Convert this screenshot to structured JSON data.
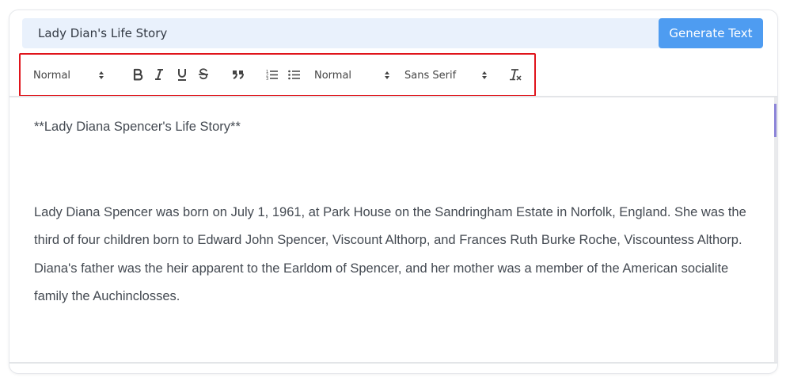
{
  "prompt": {
    "value": "Lady Dian's Life Story"
  },
  "generate_button": {
    "label": "Generate Text"
  },
  "toolbar": {
    "header_select": "Normal",
    "size_select": "Normal",
    "font_select": "Sans Serif",
    "icons": [
      "bold-icon",
      "italic-icon",
      "underline-icon",
      "strikethrough-icon",
      "blockquote-icon",
      "ordered-list-icon",
      "bullet-list-icon",
      "clear-format-icon"
    ]
  },
  "editor": {
    "heading": "**Lady Diana Spencer's Life Story**",
    "paragraph": "Lady Diana Spencer was born on July 1, 1961, at Park House on the Sandringham Estate in Norfolk, England. She was the third of four children born to Edward John Spencer, Viscount Althorp, and Frances Ruth Burke Roche, Viscountess Althorp. Diana's father was the heir apparent to the Earldom of Spencer, and her mother was a member of the American socialite family the Auchinclosses."
  },
  "colors": {
    "accent": "#4e9cf1",
    "input_bg": "#e9f1fc",
    "highlight_border": "#e0141b",
    "scroll_thumb": "#8c84d8"
  }
}
